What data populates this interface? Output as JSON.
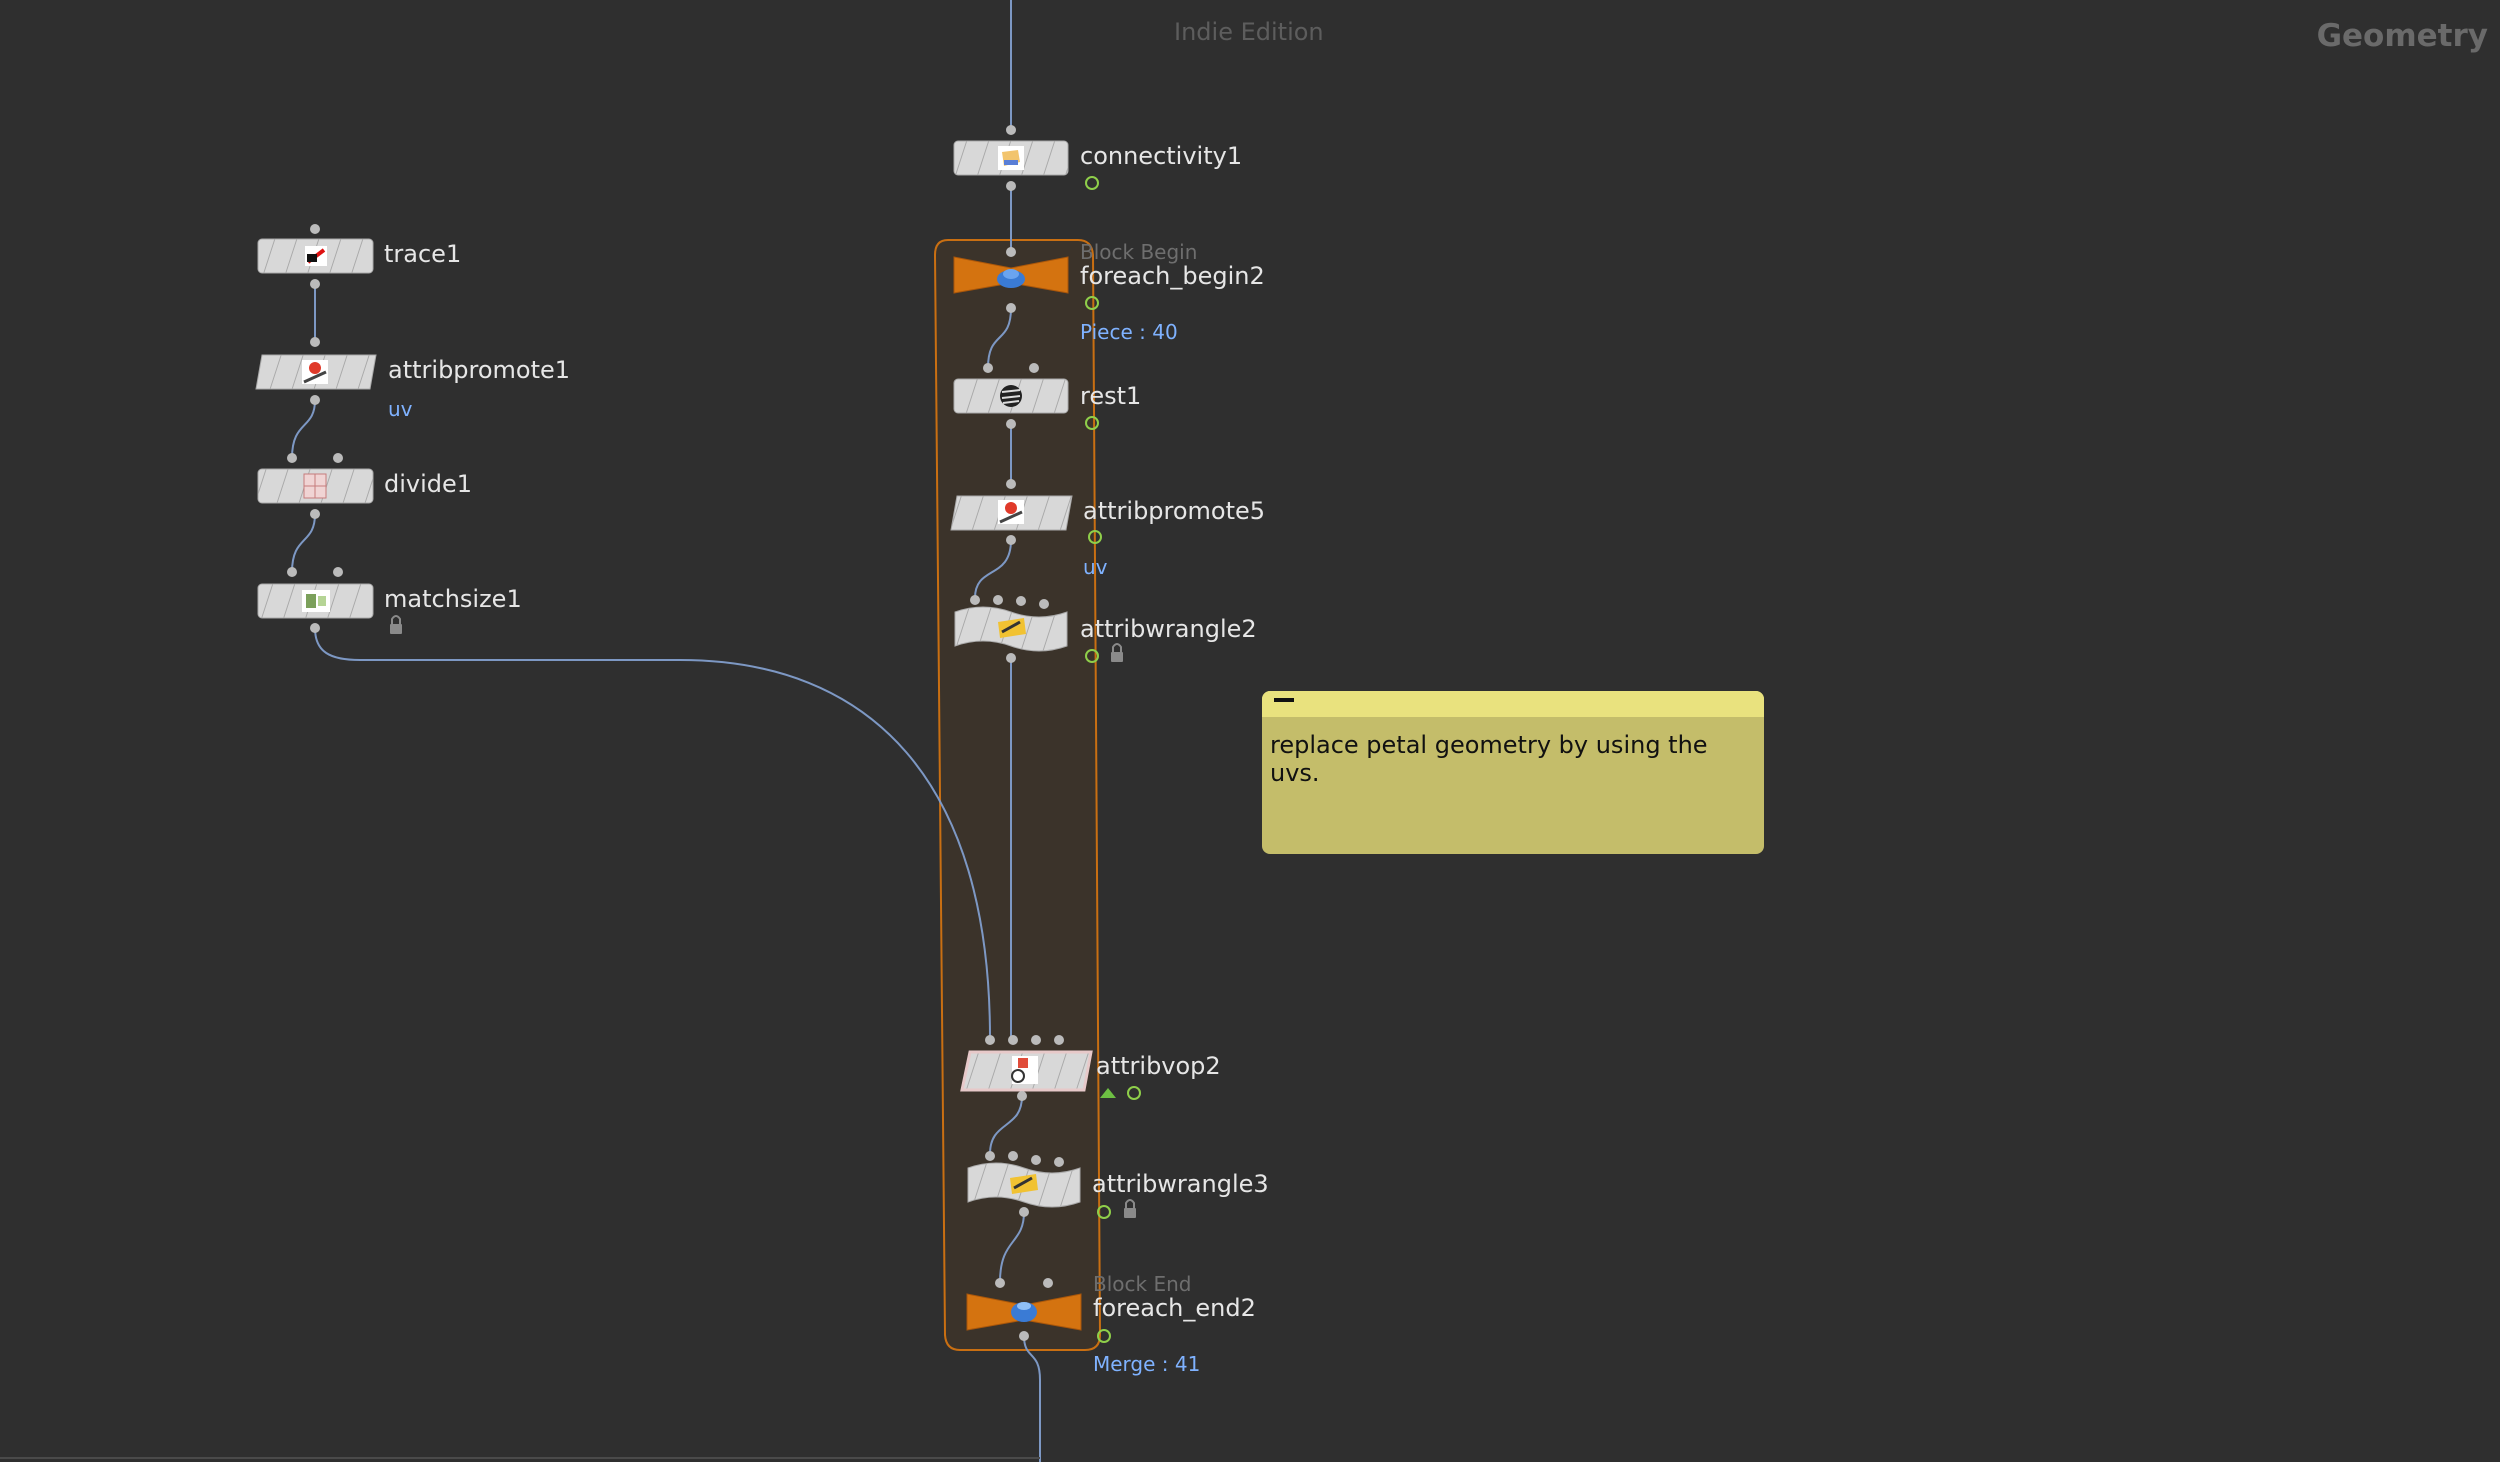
{
  "header": {
    "edition": "Indie Edition",
    "context": "Geometry"
  },
  "nodes": {
    "trace1": {
      "name": "trace1"
    },
    "attribpromote1": {
      "name": "attribpromote1",
      "attr": "uv"
    },
    "divide1": {
      "name": "divide1"
    },
    "matchsize1": {
      "name": "matchsize1"
    },
    "connectivity1": {
      "name": "connectivity1"
    },
    "foreach_begin2": {
      "name": "foreach_begin2",
      "block": "Block Begin",
      "info": "Piece : 40"
    },
    "rest1": {
      "name": "rest1"
    },
    "attribpromote5": {
      "name": "attribpromote5",
      "attr": "uv"
    },
    "attribwrangle2": {
      "name": "attribwrangle2"
    },
    "attribvop2": {
      "name": "attribvop2"
    },
    "attribwrangle3": {
      "name": "attribwrangle3"
    },
    "foreach_end2": {
      "name": "foreach_end2",
      "block": "Block End",
      "info": "Merge : 41"
    }
  },
  "sticky_note": {
    "text": "replace petal geometry by using the uvs."
  },
  "colors": {
    "background": "#2f2f2f",
    "wire": "#7d98c4",
    "block": "#d07312",
    "node": "#d6d6d6",
    "sticky": "#c4bd6a"
  }
}
